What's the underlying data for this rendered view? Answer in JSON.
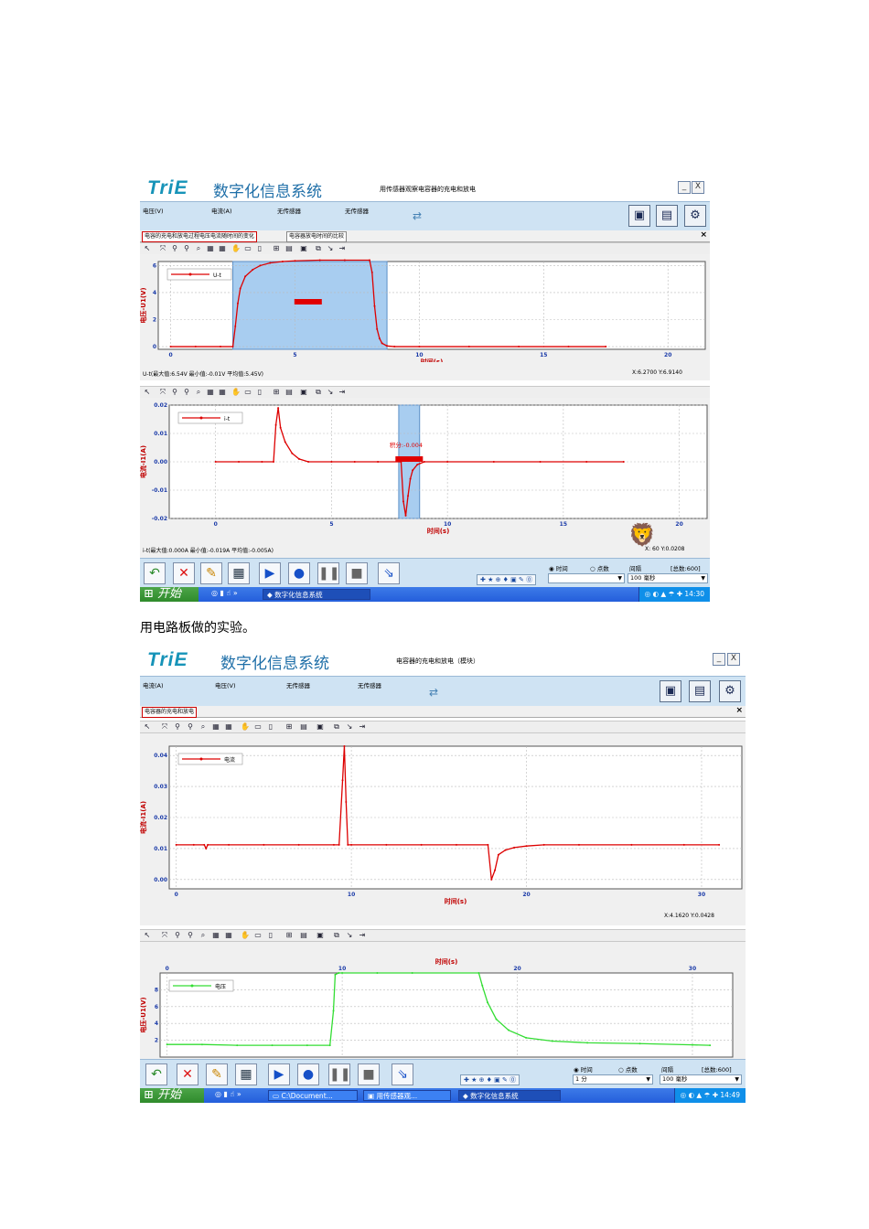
{
  "caption": "用电路板做的实验。",
  "colors": {
    "trace_red": "#dd0000",
    "trace_green": "#33dd33",
    "selection": "#a8cdf0",
    "accent": "#1f6fa8"
  },
  "shot1": {
    "logo": "TriE",
    "app_title": "数字化信息系统",
    "subtitle": "用传感器观察电容器的充电和放电",
    "window_minimize": "_",
    "window_close": "X",
    "sensors": [
      "电压(V)",
      "电流(A)",
      "无传感器",
      "无传感器"
    ],
    "tabs": [
      "电容的充电和放电过程电压电流随时间的变化",
      "电容器放电时间的比较"
    ],
    "tab_close": "×",
    "icons": [
      "save-icon",
      "export-icon",
      "settings-icon"
    ],
    "chart_top": {
      "legend": "U-t",
      "ylabel": "电压-U1(V)",
      "xlabel": "时间(s)",
      "stats": "U-t(最大值:6.54V 最小值:-0.01V 平均值:5.45V)",
      "readout": "X:6.2700 Y:6.9140",
      "annotation": ""
    },
    "chart_bottom": {
      "legend": "i-t",
      "ylabel": "电流-I1(A)",
      "xlabel": "时间(s)",
      "stats": "i-t(最大值:0.000A 最小值:-0.019A 平均值:-0.005A)",
      "readout": "X:  60 Y:0.0208",
      "annotation": "积分:-0.004"
    },
    "mode_time": "时间",
    "mode_points": "点数",
    "interval_label": "间隔",
    "total": "[总数:600]",
    "interval_value": "100 毫秒",
    "taskbar": {
      "start": "开始",
      "items": [
        "数字化信息系统"
      ],
      "clock": "14:30"
    }
  },
  "shot2": {
    "logo": "TriE",
    "app_title": "数字化信息系统",
    "subtitle": "电容器的充电和放电（模块）",
    "window_minimize": "_",
    "window_close": "X",
    "sensors": [
      "电流(A)",
      "电压(V)",
      "无传感器",
      "无传感器"
    ],
    "tabs": [
      "电容器的充电和放电"
    ],
    "tab_close": "×",
    "icons": [
      "save-icon",
      "export-icon",
      "settings-icon"
    ],
    "chart_top": {
      "legend": "电流",
      "ylabel": "电流-I1(A)",
      "xlabel": "时间(s)",
      "readout": "X:4.1620 Y:0.0428"
    },
    "chart_bottom": {
      "legend": "电压",
      "ylabel": "电压-U1(V)",
      "xlabel": "时间(s)"
    },
    "mode_time": "时间",
    "mode_points": "点数",
    "interval_label": "间隔",
    "total": "[总数:600]",
    "span_value": "1 分",
    "interval_value": "100 毫秒",
    "taskbar": {
      "start": "开始",
      "items": [
        "C:\\Document...",
        "用传感器观...",
        "数字化信息系统"
      ],
      "clock": "14:49"
    }
  },
  "chart_data": [
    {
      "type": "line",
      "name": "shot1-voltage",
      "xlabel": "时间(s)",
      "ylabel": "电压-U1(V)",
      "xlim": [
        -0.5,
        21.5
      ],
      "ylim": [
        -0.2,
        6.3
      ],
      "xticks": [
        0,
        5,
        10,
        15,
        20
      ],
      "yticks": [
        0,
        2,
        4,
        6
      ],
      "grid": true,
      "legend_position": "top-left",
      "selection_x": [
        2.5,
        8.7
      ],
      "series": [
        {
          "name": "U-t",
          "x": [
            0,
            1,
            2,
            2.5,
            2.6,
            2.7,
            2.8,
            3,
            3.3,
            3.6,
            4,
            4.5,
            5,
            6,
            7,
            8,
            8.1,
            8.2,
            8.3,
            8.4,
            8.5,
            8.7,
            9,
            10,
            12,
            14,
            16,
            17.5
          ],
          "y": [
            0,
            0,
            0,
            0,
            1.5,
            3.2,
            4.3,
            5.2,
            5.7,
            6.0,
            6.2,
            6.3,
            6.35,
            6.4,
            6.4,
            6.4,
            5.5,
            3.0,
            1.3,
            0.6,
            0.25,
            0.05,
            0,
            0,
            0,
            0,
            0,
            0
          ]
        }
      ]
    },
    {
      "type": "line",
      "name": "shot1-current",
      "xlabel": "时间(s)",
      "ylabel": "电流-I1(A)",
      "xlim": [
        -2,
        21.2
      ],
      "ylim": [
        -0.02,
        0.02
      ],
      "xticks": [
        0,
        5,
        10,
        15,
        20
      ],
      "yticks": [
        -0.02,
        -0.01,
        0,
        0.01,
        0.02
      ],
      "grid": true,
      "legend_position": "top-left",
      "selection_x": [
        7.9,
        8.8
      ],
      "series": [
        {
          "name": "i-t",
          "x": [
            0,
            1,
            2,
            2.5,
            2.6,
            2.7,
            2.8,
            3,
            3.3,
            3.6,
            4,
            5,
            6,
            7,
            8,
            8.1,
            8.2,
            8.3,
            8.4,
            8.5,
            8.7,
            9,
            10,
            12,
            14,
            16,
            17.6
          ],
          "y": [
            0,
            0,
            0,
            0,
            0.013,
            0.019,
            0.012,
            0.007,
            0.003,
            0.001,
            0,
            0,
            0,
            0,
            0,
            -0.014,
            -0.019,
            -0.012,
            -0.006,
            -0.003,
            -0.001,
            0,
            0,
            0,
            0,
            0,
            0
          ]
        }
      ]
    },
    {
      "type": "line",
      "name": "shot2-current",
      "xlabel": "时间(s)",
      "ylabel": "电流-I1(A)",
      "xlim": [
        -0.4,
        32.3
      ],
      "ylim": [
        -0.003,
        0.043
      ],
      "xticks": [
        0,
        10,
        20,
        30
      ],
      "yticks": [
        0.0,
        0.01,
        0.02,
        0.03,
        0.04
      ],
      "grid": true,
      "legend_position": "top-left",
      "series": [
        {
          "name": "电流",
          "x": [
            0,
            1,
            1.6,
            1.7,
            1.8,
            3,
            5,
            7,
            9,
            9.3,
            9.5,
            9.6,
            9.7,
            9.8,
            10,
            12,
            14,
            16,
            17.8,
            18.0,
            18.2,
            18.4,
            18.8,
            19.3,
            20,
            21,
            23,
            26,
            29,
            31
          ],
          "y": [
            0.0112,
            0.0112,
            0.0112,
            0.01,
            0.0112,
            0.0112,
            0.0112,
            0.0112,
            0.0112,
            0.0112,
            0.032,
            0.043,
            0.025,
            0.0112,
            0.0112,
            0.0112,
            0.0112,
            0.0112,
            0.0112,
            0.0,
            0.003,
            0.008,
            0.0095,
            0.0103,
            0.0108,
            0.0112,
            0.0112,
            0.0112,
            0.0112,
            0.0112
          ]
        }
      ]
    },
    {
      "type": "line",
      "name": "shot2-voltage",
      "xlabel": "时间(s)",
      "ylabel": "电压-U1(V)",
      "xlim": [
        -0.4,
        32.3
      ],
      "ylim": [
        0,
        10
      ],
      "xticks": [
        0,
        10,
        20,
        30
      ],
      "yticks": [
        2,
        4,
        6,
        8
      ],
      "grid": true,
      "legend_position": "top-left",
      "series": [
        {
          "name": "电压",
          "x": [
            0,
            2,
            4,
            6,
            8,
            9.3,
            9.5,
            9.6,
            9.8,
            10,
            12,
            14,
            17.8,
            18,
            18.3,
            18.8,
            19.5,
            20.5,
            22,
            24,
            27,
            30,
            31
          ],
          "y": [
            1.5,
            1.5,
            1.4,
            1.4,
            1.4,
            1.4,
            5.5,
            9.8,
            10,
            10,
            10,
            10,
            10,
            8.5,
            6.5,
            4.5,
            3.2,
            2.3,
            1.9,
            1.7,
            1.6,
            1.45,
            1.4
          ]
        }
      ]
    }
  ]
}
